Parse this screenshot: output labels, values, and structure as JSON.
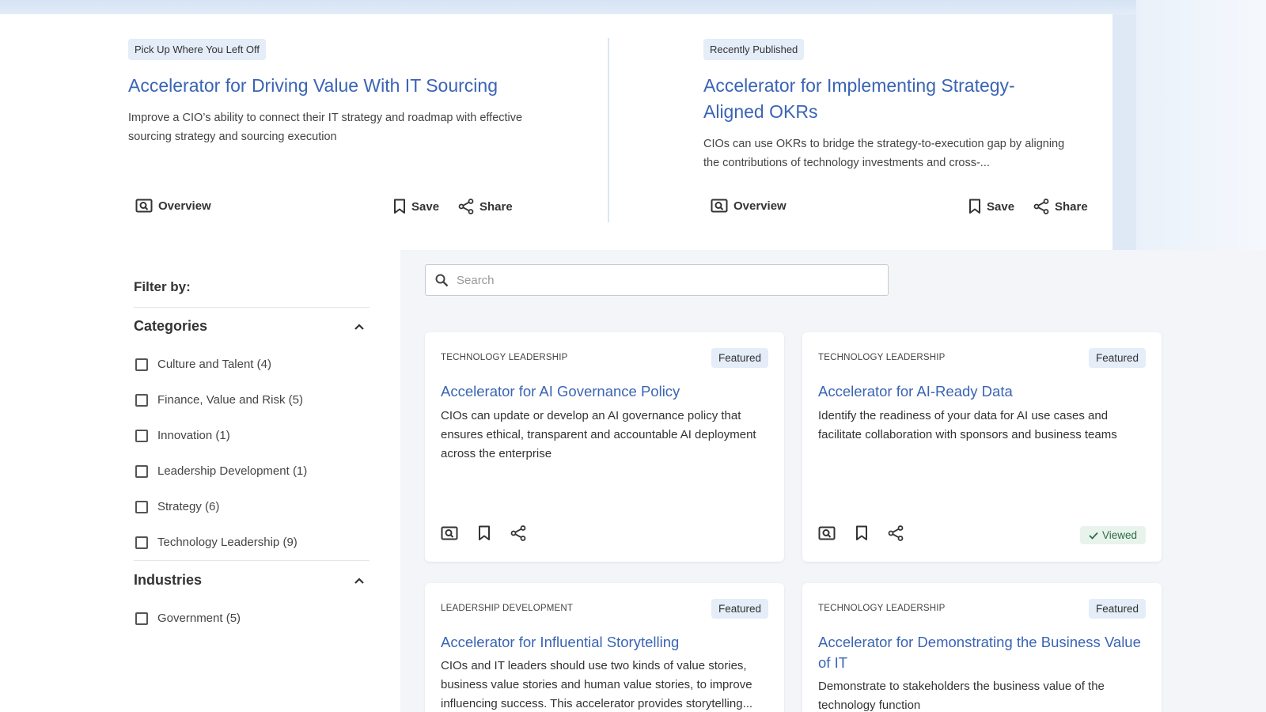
{
  "hero": [
    {
      "pill": "Pick Up Where You Left Off",
      "title": "Accelerator for Driving Value With IT Sourcing",
      "description": "Improve a CIO’s ability to connect their IT strategy and roadmap with effective sourcing strategy and sourcing execution",
      "overview_label": "Overview",
      "save_label": "Save",
      "share_label": "Share"
    },
    {
      "pill": "Recently Published",
      "title": "Accelerator for Implementing Strategy-Aligned OKRs",
      "description": "CIOs can use OKRs to bridge the strategy-to-execution gap by aligning the contributions of technology investments and cross-...",
      "overview_label": "Overview",
      "save_label": "Save",
      "share_label": "Share"
    }
  ],
  "filters": {
    "heading": "Filter by:",
    "categories": {
      "label": "Categories",
      "items": [
        {
          "label": "Culture and Talent (4)",
          "checked": false
        },
        {
          "label": "Finance, Value and Risk (5)",
          "checked": false
        },
        {
          "label": "Innovation (1)",
          "checked": false
        },
        {
          "label": "Leadership Development (1)",
          "checked": false
        },
        {
          "label": "Strategy (6)",
          "checked": false
        },
        {
          "label": "Technology Leadership (9)",
          "checked": false
        }
      ]
    },
    "industries": {
      "label": "Industries",
      "items": [
        {
          "label": "Government (5)",
          "checked": false
        }
      ]
    }
  },
  "search": {
    "placeholder": "Search",
    "value": ""
  },
  "cards": [
    {
      "category": "TECHNOLOGY LEADERSHIP",
      "badge": "Featured",
      "title": "Accelerator for AI Governance Policy",
      "description": "CIOs can update or develop an AI governance policy that ensures ethical, transparent and accountable AI deployment across the enterprise",
      "status": ""
    },
    {
      "category": "TECHNOLOGY LEADERSHIP",
      "badge": "Featured",
      "title": "Accelerator for AI-Ready Data",
      "description": "Identify the readiness of your data for AI use cases and facilitate collaboration with sponsors and business teams",
      "status": "Viewed"
    },
    {
      "category": "LEADERSHIP DEVELOPMENT",
      "badge": "Featured",
      "title": "Accelerator for Influential Storytelling",
      "description": "CIOs and IT leaders should use two kinds of value stories, business value stories and human value stories, to improve influencing success. This accelerator provides storytelling...",
      "status": ""
    },
    {
      "category": "TECHNOLOGY LEADERSHIP",
      "badge": "Featured",
      "title": "Accelerator for Demonstrating the Business Value of IT",
      "description": "Demonstrate to stakeholders the business value of the technology function",
      "status": ""
    }
  ],
  "colors": {
    "link": "#3a64b4",
    "pill_bg": "#e4edf8",
    "viewed_bg": "#e8f3ec",
    "viewed_text": "#2d6b45"
  }
}
